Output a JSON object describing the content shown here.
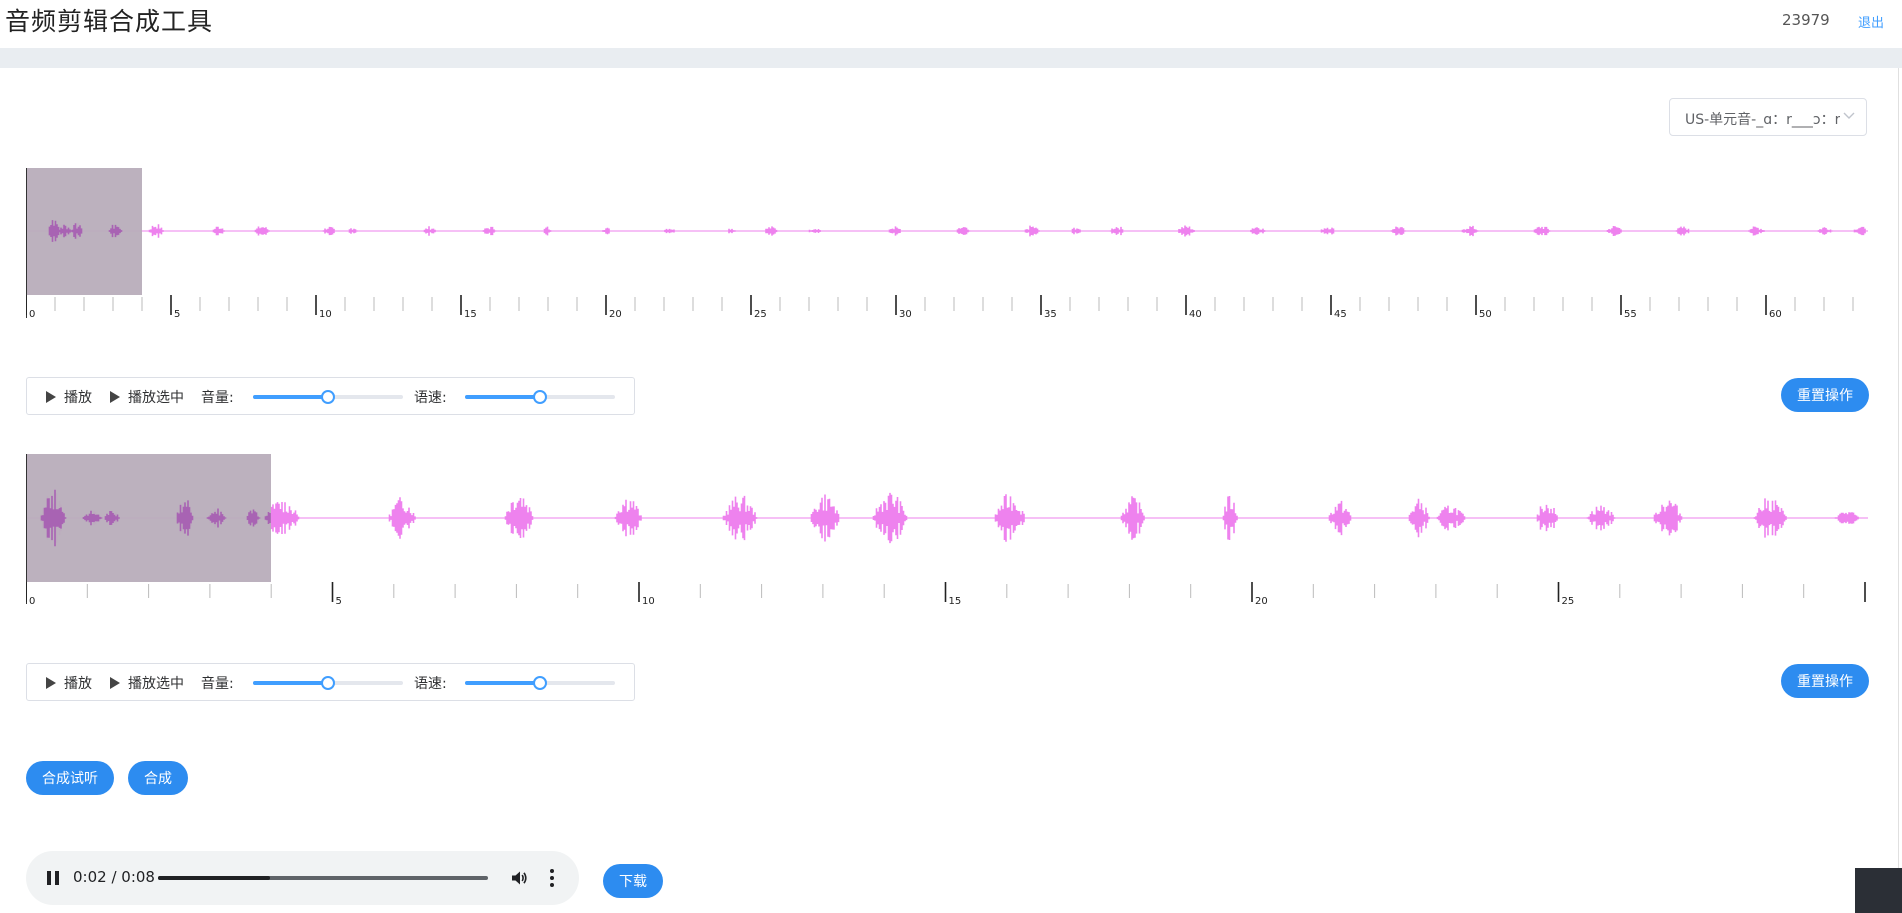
{
  "header": {
    "title": "音频剪辑合成工具",
    "user_id": "23979",
    "logout": "退出"
  },
  "colors": {
    "accent": "#409eff",
    "button": "#2d8cf0",
    "wave": "#ee82ee",
    "selection": "#b8adbb"
  },
  "select": {
    "value": "US-单元音-_ɑ：r___ɔ：r"
  },
  "track1": {
    "ruler_labels": [
      "0",
      "5",
      "10",
      "15",
      "20",
      "25",
      "30",
      "35",
      "40",
      "45",
      "50",
      "55",
      "60"
    ],
    "controls": {
      "play": "播放",
      "play_selected": "播放选中",
      "volume_label": "音量:",
      "speed_label": "语速:",
      "volume": 0.5,
      "speed": 0.5
    },
    "reset": "重置操作"
  },
  "track2": {
    "ruler_labels": [
      "0",
      "5",
      "10",
      "15",
      "20",
      "25"
    ],
    "controls": {
      "play": "播放",
      "play_selected": "播放选中",
      "volume_label": "音量:",
      "speed_label": "语速:",
      "volume": 0.5,
      "speed": 0.5
    },
    "reset": "重置操作"
  },
  "actions": {
    "preview": "合成试听",
    "compose": "合成"
  },
  "player": {
    "time": "0:02 / 0:08",
    "progress": 0.34
  },
  "download": "下载",
  "icons": [
    "play-icon",
    "pause-icon",
    "volume-icon",
    "more-vert-icon",
    "chevron-down-icon"
  ]
}
